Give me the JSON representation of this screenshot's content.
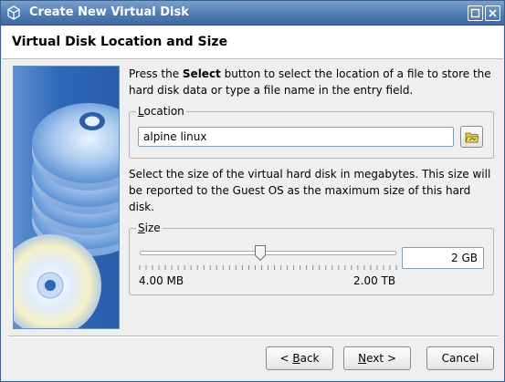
{
  "window": {
    "title": "Create New Virtual Disk",
    "icon": "virtualbox-icon"
  },
  "header": {
    "title": "Virtual Disk Location and Size"
  },
  "location_description": {
    "prefix": "Press the ",
    "bold": "Select",
    "suffix": " button to select the location of a file to store the hard disk data or type a file name in the entry field."
  },
  "location_group": {
    "legend_mnemonic": "L",
    "legend_rest": "ocation",
    "value": "alpine linux",
    "select_button_icon": "folder-open-icon"
  },
  "size_description": "Select the size of the virtual hard disk in megabytes. This size will be reported to the Guest OS as the maximum size of this hard disk.",
  "size_group": {
    "legend_mnemonic": "S",
    "legend_rest": "ize",
    "min_label": "4.00 MB",
    "max_label": "2.00 TB",
    "value": "2 GB",
    "slider_fraction": 0.47
  },
  "buttons": {
    "back_prefix": "< ",
    "back_mnemonic": "B",
    "back_rest": "ack",
    "next_mnemonic": "N",
    "next_rest": "ext >",
    "cancel": "Cancel"
  },
  "colors": {
    "titlebar": "#4f7cb3",
    "side_image": "#2e67b8"
  }
}
